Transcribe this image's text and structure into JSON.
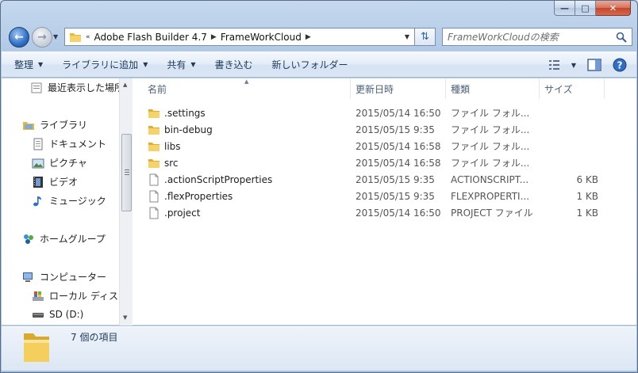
{
  "window": {
    "minimize_glyph": "—",
    "maximize_glyph": "□",
    "close_glyph": "✕"
  },
  "address": {
    "root_glyph": "«",
    "crumbs": [
      "Adobe Flash Builder 4.7",
      "FrameWorkCloud"
    ],
    "search_placeholder": "FrameWorkCloudの検索"
  },
  "toolbar": {
    "organize": "整理",
    "add_to_library": "ライブラリに追加",
    "share": "共有",
    "burn": "書き込む",
    "new_folder": "新しいフォルダー"
  },
  "nav": {
    "recent": "最近表示した場所",
    "libraries": "ライブラリ",
    "documents": "ドキュメント",
    "pictures": "ピクチャ",
    "videos": "ビデオ",
    "music": "ミュージック",
    "homegroup": "ホームグループ",
    "computer": "コンピューター",
    "local_disk": "ローカル ディスク",
    "sd": "SD (D:)"
  },
  "columns": {
    "name": "名前",
    "date": "更新日時",
    "type": "種類",
    "size": "サイズ"
  },
  "files": [
    {
      "name": ".settings",
      "date": "2015/05/14 16:50",
      "type": "ファイル フォル...",
      "size": "",
      "kind": "folder"
    },
    {
      "name": "bin-debug",
      "date": "2015/05/15 9:35",
      "type": "ファイル フォル...",
      "size": "",
      "kind": "folder"
    },
    {
      "name": "libs",
      "date": "2015/05/14 16:58",
      "type": "ファイル フォル...",
      "size": "",
      "kind": "folder"
    },
    {
      "name": "src",
      "date": "2015/05/14 16:58",
      "type": "ファイル フォル...",
      "size": "",
      "kind": "folder"
    },
    {
      "name": ".actionScriptProperties",
      "date": "2015/05/15 9:35",
      "type": "ACTIONSCRIPT...",
      "size": "6 KB",
      "kind": "file"
    },
    {
      "name": ".flexProperties",
      "date": "2015/05/15 9:35",
      "type": "FLEXPROPERTI...",
      "size": "1 KB",
      "kind": "file"
    },
    {
      "name": ".project",
      "date": "2015/05/14 16:50",
      "type": "PROJECT ファイル",
      "size": "1 KB",
      "kind": "file"
    }
  ],
  "status": {
    "item_count": "7 個の項目"
  },
  "colors": {
    "accent": "#2f6fc4",
    "folder": "#f2c44a"
  }
}
